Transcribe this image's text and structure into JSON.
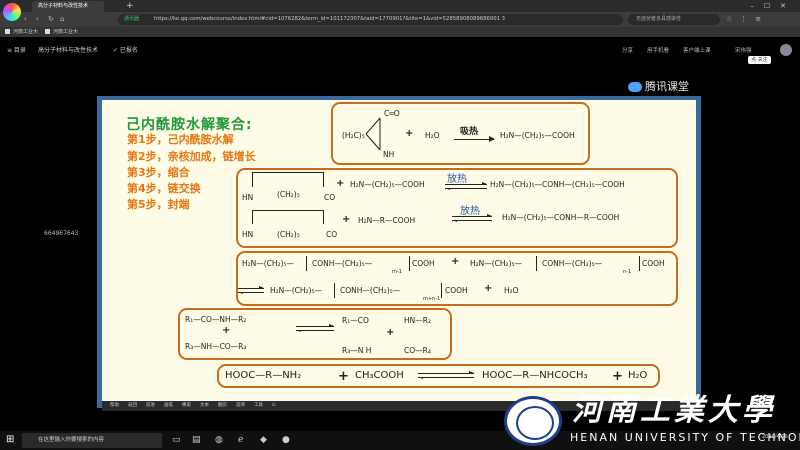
{
  "browser": {
    "tabs": [
      {
        "title": "高分子材料与改性技术",
        "active": true
      },
      {
        "title": "河南工业大",
        "active": false
      },
      {
        "title": "河南工业大",
        "active": false
      }
    ],
    "new_tab": "+",
    "nav": {
      "back": "‹",
      "forward": "›",
      "reload": "↻",
      "home": "⌂"
    },
    "secure_label": "通讯器",
    "url": "https://ke.qq.com/webcourse/index.html#cid=1076282&term_id=101172307&taid=1770901?&tite=1&vid=52858908089686001 3",
    "search_placeholder": "无症状者多具感染性"
  },
  "bookmarks": [
    {
      "label": "河南工业大"
    },
    {
      "label": "河南工业大"
    }
  ],
  "course_bar": {
    "menu_label": "≡ 目录",
    "course_title": "高分子材料与改性技术",
    "enrolled_label": "✓ 已报名",
    "right_items": [
      "分享",
      "用手机看",
      "客户端上课"
    ],
    "user_name": "宋伟强",
    "follow_label": "点·关注"
  },
  "watermark": "664967643",
  "slide": {
    "brand": "腾讯课堂",
    "title": "己内酰胺水解聚合:",
    "steps": [
      "第1步，己内酰胺水解",
      "第2步，亲核加成，链增长",
      "第3步，缩合",
      "第4步，链交换",
      "第5步，封端"
    ],
    "rxn1": {
      "ring_top": "C═O",
      "ring_left": "(H₂C)₅",
      "ring_bottom": "NH",
      "plus": "+",
      "water": "H₂O",
      "heat": "吸热",
      "product": "H₂N—(CH₂)₅—COOH"
    },
    "rxn2": {
      "heat_a": "放热",
      "ring_a": [
        "HN",
        "(CH₂)₅",
        "CO"
      ],
      "reagent_a": "H₂N—(CH₂)₅—COOH",
      "product_a": "H₂N—(CH₂)₅—CONH—(CH₂)₅—COOH",
      "heat_b": "放热",
      "ring_b": [
        "HN",
        "(CH₂)₅",
        "CO"
      ],
      "reagent_b": "H₂N—R—COOH",
      "product_b": "H₂N—(CH₂)₅—CONH—R—COOH"
    },
    "rxn3": {
      "left_a": "H₂N—(CH₂)₅—",
      "repeat_a": "CONH—(CH₂)₅—",
      "n_a": "m-1",
      "end_a": "COOH",
      "left_b": "H₂N—(CH₂)₅—",
      "repeat_b": "CONH—(CH₂)₅—",
      "n_b": "n-1",
      "end_b": "COOH",
      "prod_left": "H₂N—(CH₂)₅—",
      "prod_repeat": "CONH—(CH₂)₅—",
      "prod_n": "m+n-1",
      "prod_end": "COOH",
      "water": "H₂O"
    },
    "rxn4": {
      "a1": "R₁—CO—NH—R₂",
      "a2": "R₃—NH—CO—R₄",
      "b1": "R₁—CO",
      "b2": "R₃—N H",
      "c1": "HN—R₂",
      "c2": "CO—R₄"
    },
    "rxn5": {
      "reactant": "HOOC—R—NH₂",
      "acid": "CH₃COOH",
      "product": "HOOC—R—NHCOCH₃",
      "water": "H₂O"
    },
    "toolbar": [
      "帮助",
      "返回",
      "前进",
      "画笔",
      "橡皮",
      "文本",
      "翻页",
      "选项",
      "工具"
    ]
  },
  "university": {
    "name_zh": "河南工業大學",
    "name_en": "HENAN UNIVERSITY OF TECHNOLOGY"
  },
  "taskbar": {
    "search_placeholder": "在这里输入你要搜索的内容",
    "time": "2020/4/16"
  }
}
